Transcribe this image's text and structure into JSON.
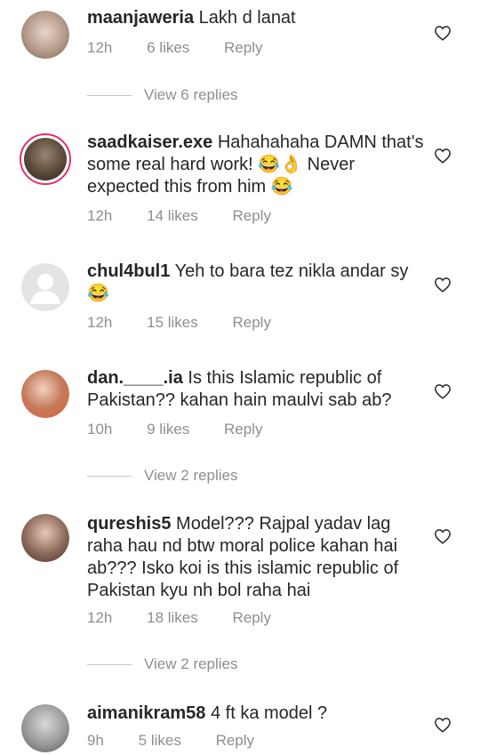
{
  "comments": [
    {
      "user": "maanjaweria",
      "text": "Lakh d lanat",
      "time": "12h",
      "likes": "6 likes",
      "reply": "Reply",
      "view_replies": "View 6 replies",
      "avatar_color": "#b59a8a"
    },
    {
      "user": "saadkaiser.exe",
      "text": "Hahahahaha DAMN that's some real hard work! 😂👌 Never expected this from him 😂",
      "time": "12h",
      "likes": "14 likes",
      "reply": "Reply",
      "avatar_color": "#5a4a3a"
    },
    {
      "user": "chul4bul1",
      "text": "Yeh to bara tez nikla andar sy 😂",
      "time": "12h",
      "likes": "15 likes",
      "reply": "Reply",
      "avatar_color": "#dbdbdb"
    },
    {
      "user": "dan.____.ia",
      "text": "Is this Islamic republic of Pakistan?? kahan hain maulvi sab ab?",
      "time": "10h",
      "likes": "9 likes",
      "reply": "Reply",
      "view_replies": "View 2 replies",
      "avatar_color": "#c47a5a"
    },
    {
      "user": "qureshis5",
      "text": "Model??? Rajpal yadav lag raha hau nd btw moral police kahan hai ab??? Isko koi is this islamic republic of Pakistan kyu nh bol raha hai",
      "time": "12h",
      "likes": "18 likes",
      "reply": "Reply",
      "view_replies": "View 2 replies",
      "avatar_color": "#8c6a5a"
    },
    {
      "user": "aimanikram58",
      "text": "4 ft ka model ?",
      "time": "9h",
      "likes": "5 likes",
      "reply": "Reply",
      "avatar_color": "#9a9a9a"
    }
  ]
}
